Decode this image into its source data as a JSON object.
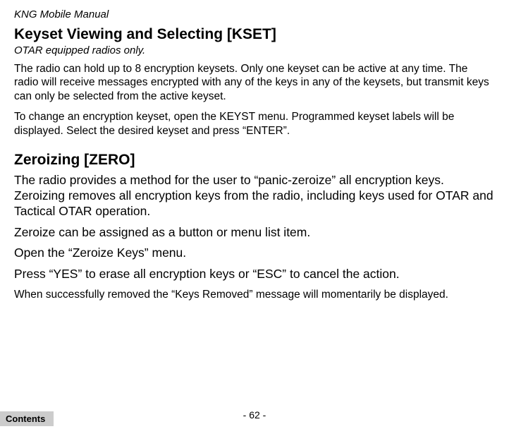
{
  "header": {
    "title": "KNG Mobile Manual"
  },
  "section1": {
    "heading": "Keyset Viewing and Selecting [KSET]",
    "subtitle": "OTAR equipped radios only.",
    "para1": "The radio can hold up to 8 encryption keysets. Only one keyset can be active at any time. The radio will receive messages encrypted with any of the keys in any of the keysets, but transmit keys can only be selected from the active keyset.",
    "para2": "To change an encryption keyset, open the KEYST menu. Programmed keyset labels will be displayed. Select the desired keyset and press “ENTER”."
  },
  "section2": {
    "heading": "Zeroizing [ZERO]",
    "para1": "The radio provides a method for the user to “panic-zeroize” all encryption keys. Zeroizing removes all encryption keys from the radio, including keys used for OTAR and Tactical OTAR operation.",
    "para2": "Zeroize can be assigned as a button or menu list item.",
    "para3": "Open the “Zeroize Keys” menu.",
    "para4": "Press “YES” to erase all encryption keys or “ESC” to cancel the action.",
    "para5": "When successfully removed the “Keys Removed” message will momentarily be displayed."
  },
  "footer": {
    "page_num": "- 62 -",
    "contents_label": "Contents"
  }
}
